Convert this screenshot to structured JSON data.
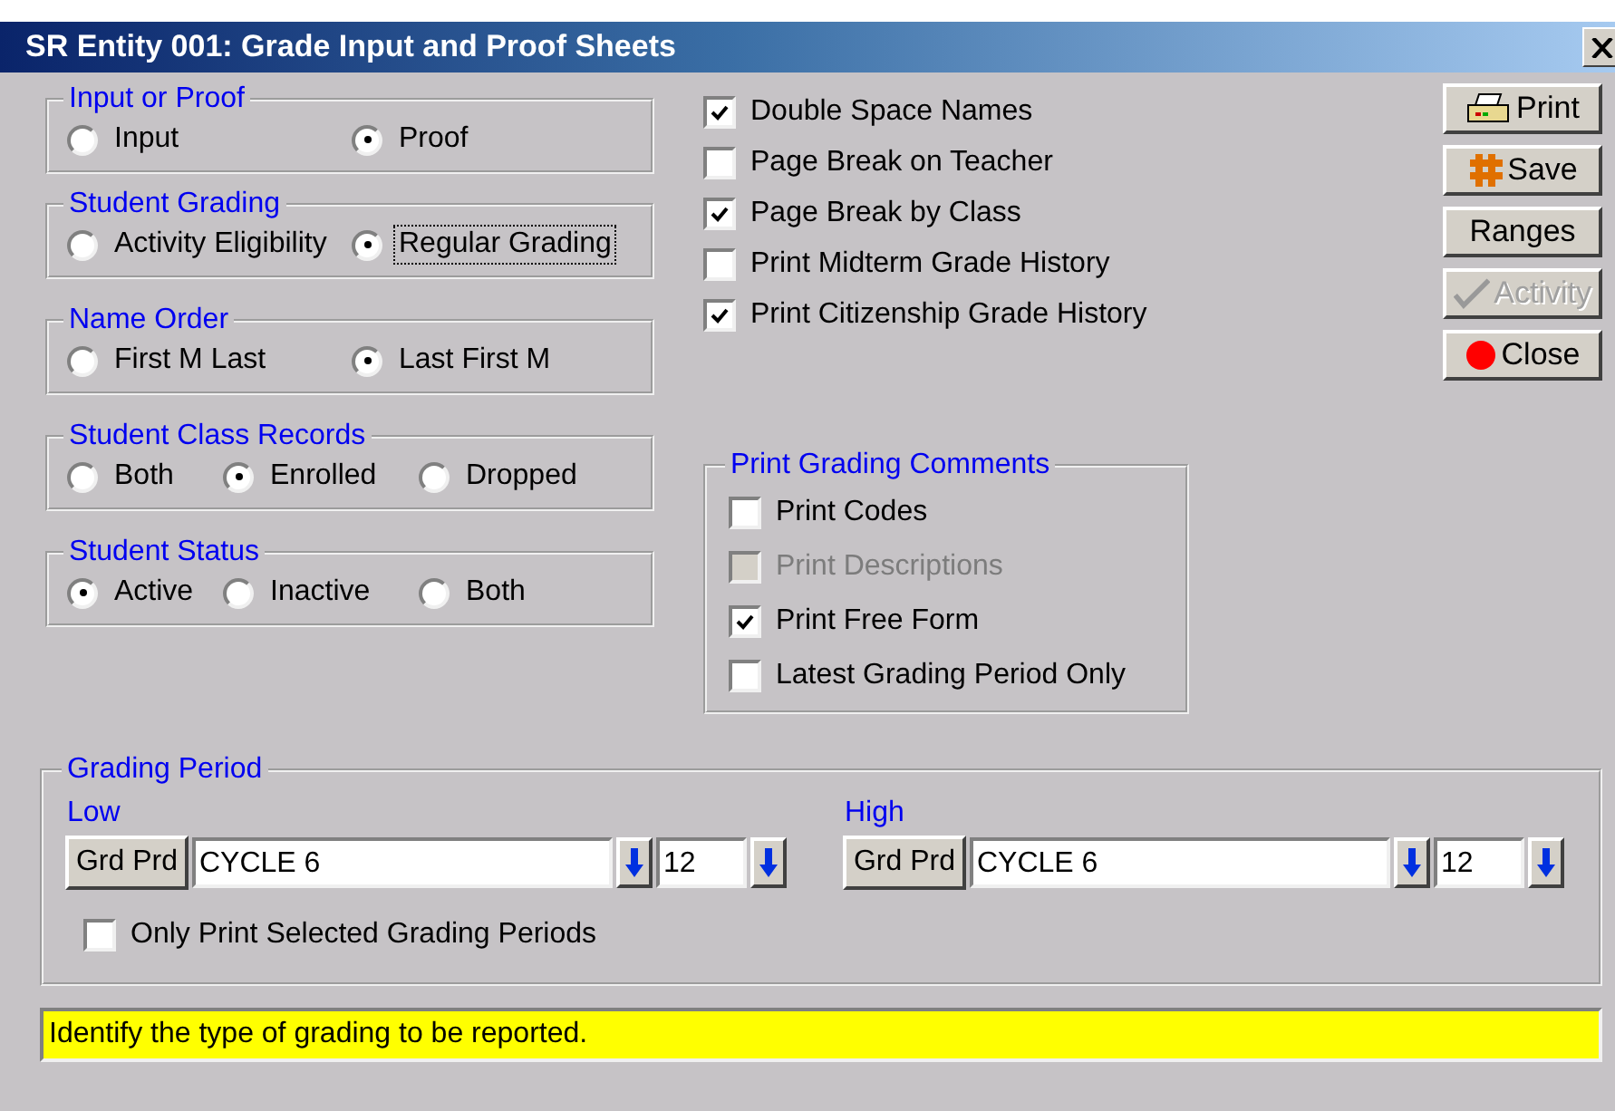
{
  "window": {
    "title": "SR Entity 001: Grade Input and Proof Sheets"
  },
  "radio_groups": [
    {
      "title": "Input or Proof",
      "options": [
        {
          "label": "Input",
          "selected": false
        },
        {
          "label": "Proof",
          "selected": true
        }
      ]
    },
    {
      "title": "Student Grading",
      "options": [
        {
          "label": "Activity Eligibility",
          "selected": false,
          "focused": false
        },
        {
          "label": "Regular Grading",
          "selected": true,
          "focused": true
        }
      ]
    },
    {
      "title": "Name Order",
      "options": [
        {
          "label": "First M Last",
          "selected": false
        },
        {
          "label": "Last First M",
          "selected": true
        }
      ]
    },
    {
      "title": "Student Class Records",
      "options": [
        {
          "label": "Both",
          "selected": false
        },
        {
          "label": "Enrolled",
          "selected": true
        },
        {
          "label": "Dropped",
          "selected": false
        }
      ]
    },
    {
      "title": "Student Status",
      "options": [
        {
          "label": "Active",
          "selected": true
        },
        {
          "label": "Inactive",
          "selected": false
        },
        {
          "label": "Both",
          "selected": false
        }
      ]
    }
  ],
  "options": [
    {
      "label": "Double Space Names",
      "checked": true
    },
    {
      "label": "Page Break on Teacher",
      "checked": false
    },
    {
      "label": "Page Break by Class",
      "checked": true
    },
    {
      "label": "Print Midterm Grade History",
      "checked": false
    },
    {
      "label": "Print Citizenship Grade History",
      "checked": true
    }
  ],
  "grading_comments": {
    "title": "Print Grading Comments",
    "options": [
      {
        "label": "Print Codes",
        "checked": false,
        "disabled": false
      },
      {
        "label": "Print Descriptions",
        "checked": false,
        "disabled": true
      },
      {
        "label": "Print Free Form",
        "checked": true,
        "disabled": false
      },
      {
        "label": "Latest Grading Period Only",
        "checked": false,
        "disabled": false
      }
    ]
  },
  "buttons": [
    {
      "label": "Print",
      "kind": "print",
      "disabled": false
    },
    {
      "label": "Save",
      "kind": "save",
      "disabled": false
    },
    {
      "label": "Ranges",
      "kind": "plain",
      "disabled": false
    },
    {
      "label": "Activity",
      "kind": "check",
      "disabled": true
    },
    {
      "label": "Close",
      "kind": "close",
      "disabled": false
    }
  ],
  "grading_period": {
    "title": "Grading Period",
    "ranges": [
      {
        "label": "Low",
        "button": "Grd Prd",
        "value": "CYCLE 6",
        "number": "12"
      },
      {
        "label": "High",
        "button": "Grd Prd",
        "value": "CYCLE 6",
        "number": "12"
      }
    ],
    "only_selected": {
      "label": "Only Print Selected Grading Periods",
      "checked": false
    }
  },
  "status_bar": "Identify the type of grading to be reported."
}
